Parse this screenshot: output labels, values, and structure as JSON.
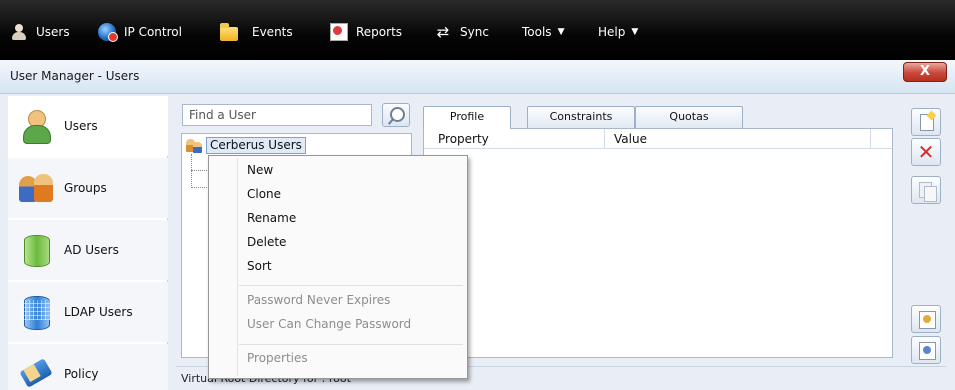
{
  "toolbar": {
    "items": [
      {
        "label": "Users",
        "icon": "user-icon"
      },
      {
        "label": "IP Control",
        "icon": "globe-icon"
      },
      {
        "label": "Events",
        "icon": "folder-icon"
      },
      {
        "label": "Reports",
        "icon": "report-icon"
      },
      {
        "label": "Sync",
        "icon": "sync-icon"
      },
      {
        "label": "Tools",
        "icon": "chevron-down-icon"
      },
      {
        "label": "Help",
        "icon": "chevron-down-icon"
      }
    ]
  },
  "window": {
    "title": "User Manager - Users",
    "close_label": "X"
  },
  "leftnav": {
    "items": [
      {
        "label": "Users",
        "icon": "users-icon"
      },
      {
        "label": "Groups",
        "icon": "groups-icon"
      },
      {
        "label": "AD Users",
        "icon": "ad-users-icon"
      },
      {
        "label": "LDAP Users",
        "icon": "ldap-users-icon"
      },
      {
        "label": "Policy",
        "icon": "policy-icon"
      }
    ]
  },
  "search": {
    "placeholder": "Find a User"
  },
  "tree": {
    "root_label": "Cerberus Users"
  },
  "tabs": [
    {
      "label": "Profile",
      "active": true
    },
    {
      "label": "Constraints",
      "active": false
    },
    {
      "label": "Quotas",
      "active": false
    }
  ],
  "grid": {
    "columns": [
      "Property",
      "Value"
    ]
  },
  "context_menu": {
    "group1": [
      {
        "label": "New",
        "enabled": true
      },
      {
        "label": "Clone",
        "enabled": true
      },
      {
        "label": "Rename",
        "enabled": true
      },
      {
        "label": "Delete",
        "enabled": true
      },
      {
        "label": "Sort",
        "enabled": true
      }
    ],
    "group2": [
      {
        "label": "Password Never Expires",
        "enabled": false
      },
      {
        "label": "User Can Change Password",
        "enabled": false
      }
    ],
    "group3": [
      {
        "label": "Properties",
        "enabled": false
      }
    ]
  },
  "side_buttons": [
    "new-icon",
    "delete-icon",
    "copy-icon",
    "import-icon",
    "export-icon"
  ],
  "status": {
    "text": "Virtual Root Directory for : root"
  },
  "colors": {
    "toolbar_bg": "#000000",
    "close_button": "#c9473a",
    "selection": "#dfe9f7"
  }
}
